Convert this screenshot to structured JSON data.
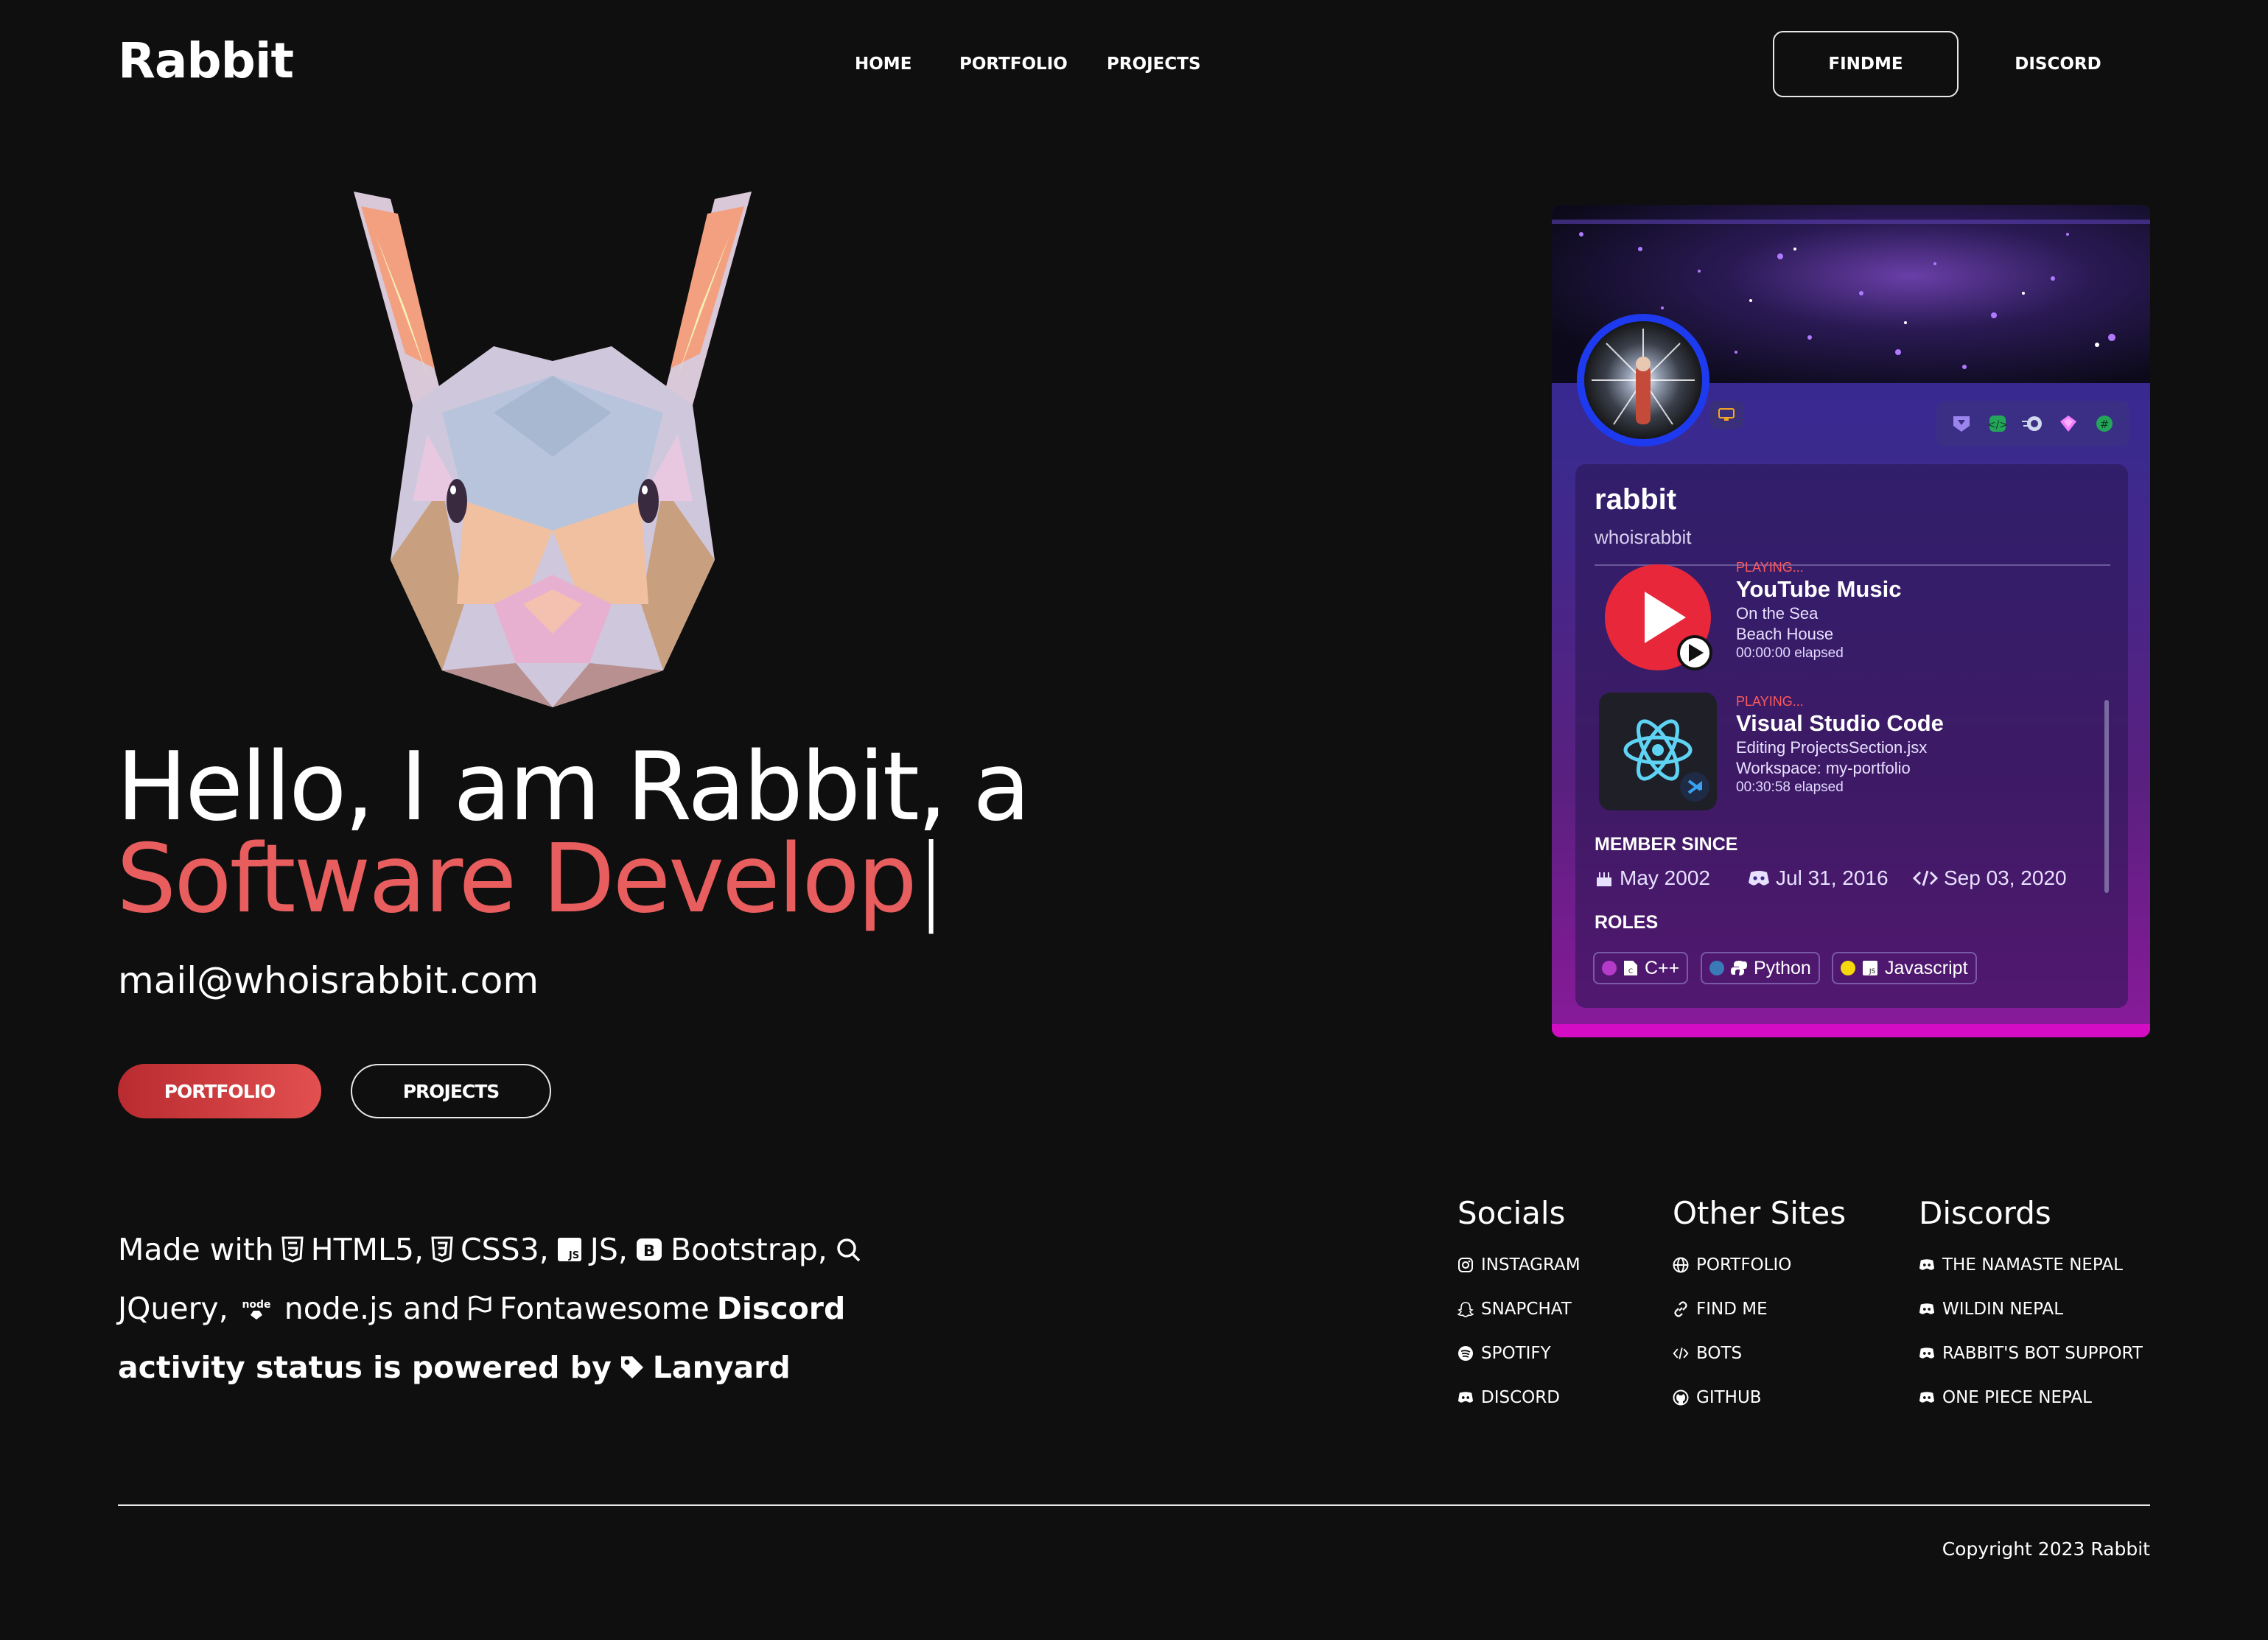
{
  "nav": {
    "logo": "Rabbit",
    "links": [
      "HOME",
      "PORTFOLIO",
      "PROJECTS"
    ],
    "findme": "FINDME",
    "discord": "DISCORD"
  },
  "hero": {
    "line1": "Hello, I am Rabbit, a",
    "line2": "Software Develop",
    "cursor": "|",
    "email": "mail@whoisrabbit.com",
    "btn_portfolio": "PORTFOLIO",
    "btn_projects": "PROJECTS"
  },
  "card": {
    "display_name": "rabbit",
    "username": "whoisrabbit",
    "activities": [
      {
        "status": "PLAYING...",
        "title": "YouTube Music",
        "line1": "On the Sea",
        "line2": "Beach House",
        "elapsed": "00:00:00 elapsed",
        "icon": "youtube-music-icon"
      },
      {
        "status": "PLAYING...",
        "title": "Visual Studio Code",
        "line1": "Editing ProjectsSection.jsx",
        "line2": "Workspace: my-portfolio",
        "elapsed": "00:30:58 elapsed",
        "icon": "react-icon"
      }
    ],
    "member_since_label": "MEMBER SINCE",
    "member_since": [
      {
        "icon": "cake-icon",
        "text": "May 2002"
      },
      {
        "icon": "discord-icon",
        "text": "Jul 31, 2016"
      },
      {
        "icon": "code-icon",
        "text": "Sep 03, 2020"
      }
    ],
    "roles_label": "ROLES",
    "roles": [
      {
        "name": "C++",
        "color": "#b43ac8"
      },
      {
        "name": "Python",
        "color": "#3a7ab8"
      },
      {
        "name": "Javascript",
        "color": "#f5d90a"
      }
    ],
    "accent_color": "#d40cc4"
  },
  "made_with": {
    "line1_parts": [
      "Made with",
      "HTML5,",
      "CSS3,",
      "JS,",
      "Bootstrap,"
    ],
    "line2_parts": [
      "JQuery,",
      "node.js and",
      "Fontawesome",
      "Discord"
    ],
    "line3_parts": [
      "activity status is powered by",
      "Lanyard"
    ]
  },
  "footer": {
    "columns": [
      {
        "heading": "Socials",
        "links": [
          {
            "label": "INSTAGRAM",
            "icon": "instagram-icon"
          },
          {
            "label": "SNAPCHAT",
            "icon": "snapchat-icon"
          },
          {
            "label": "SPOTIFY",
            "icon": "spotify-icon"
          },
          {
            "label": "DISCORD",
            "icon": "discord-icon"
          }
        ]
      },
      {
        "heading": "Other Sites",
        "links": [
          {
            "label": "PORTFOLIO",
            "icon": "globe-icon"
          },
          {
            "label": "FIND ME",
            "icon": "link-icon"
          },
          {
            "label": "BOTS",
            "icon": "code-icon"
          },
          {
            "label": "GITHUB",
            "icon": "github-icon"
          }
        ]
      },
      {
        "heading": "Discords",
        "links": [
          {
            "label": "THE NAMASTE NEPAL",
            "icon": "discord-icon"
          },
          {
            "label": "WILDIN NEPAL",
            "icon": "discord-icon"
          },
          {
            "label": "RABBIT'S BOT SUPPORT",
            "icon": "discord-icon"
          },
          {
            "label": "ONE PIECE NEPAL",
            "icon": "discord-icon"
          }
        ]
      }
    ],
    "copyright": "Copyright 2023 Rabbit"
  },
  "colors": {
    "background": "#0f0f0f",
    "accent": "#e85d5d",
    "card_avatar_ring": "#1e3aee"
  }
}
